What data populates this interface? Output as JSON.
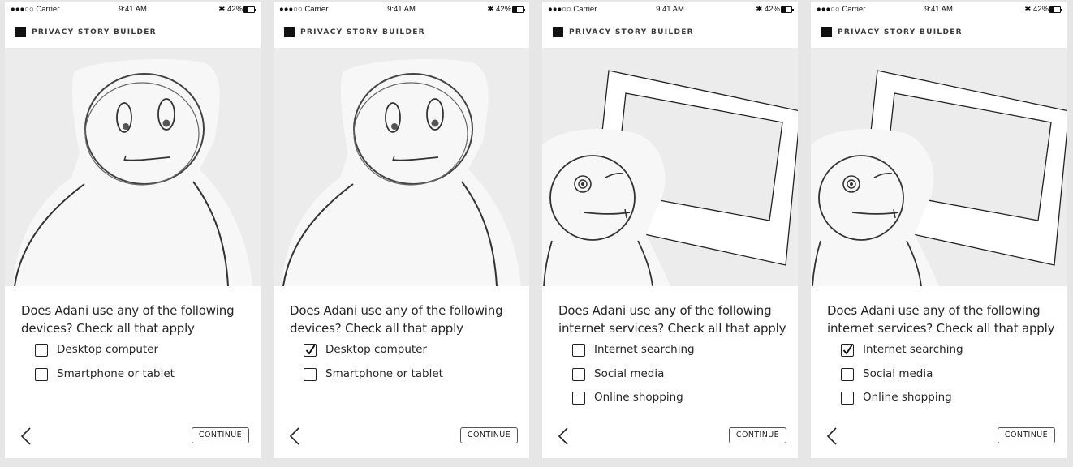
{
  "status_bar": {
    "carrier": "●●●○○ Carrier",
    "time": "9:41 AM",
    "battery": "42%"
  },
  "app": {
    "title": "PRIVACY STORY BUILDER"
  },
  "navigation": {
    "continue_label": "CONTINUE"
  },
  "screens": [
    {
      "question": "Does Adani use any of the following devices? Check all that apply",
      "options": [
        {
          "label": "Desktop computer",
          "checked": false
        },
        {
          "label": "Smartphone or tablet",
          "checked": false
        }
      ]
    },
    {
      "question": "Does Adani use any of the following devices? Check all that apply",
      "options": [
        {
          "label": "Desktop computer",
          "checked": true
        },
        {
          "label": "Smartphone or tablet",
          "checked": false
        }
      ]
    },
    {
      "question": "Does Adani use any of the following internet services? Check all that apply",
      "options": [
        {
          "label": "Internet searching",
          "checked": false
        },
        {
          "label": "Social media",
          "checked": false
        },
        {
          "label": "Online shopping",
          "checked": false
        }
      ]
    },
    {
      "question": "Does Adani use any of the following internet services? Check all that apply",
      "options": [
        {
          "label": "Internet searching",
          "checked": true
        },
        {
          "label": "Social media",
          "checked": false
        },
        {
          "label": "Online shopping",
          "checked": false
        }
      ]
    }
  ]
}
